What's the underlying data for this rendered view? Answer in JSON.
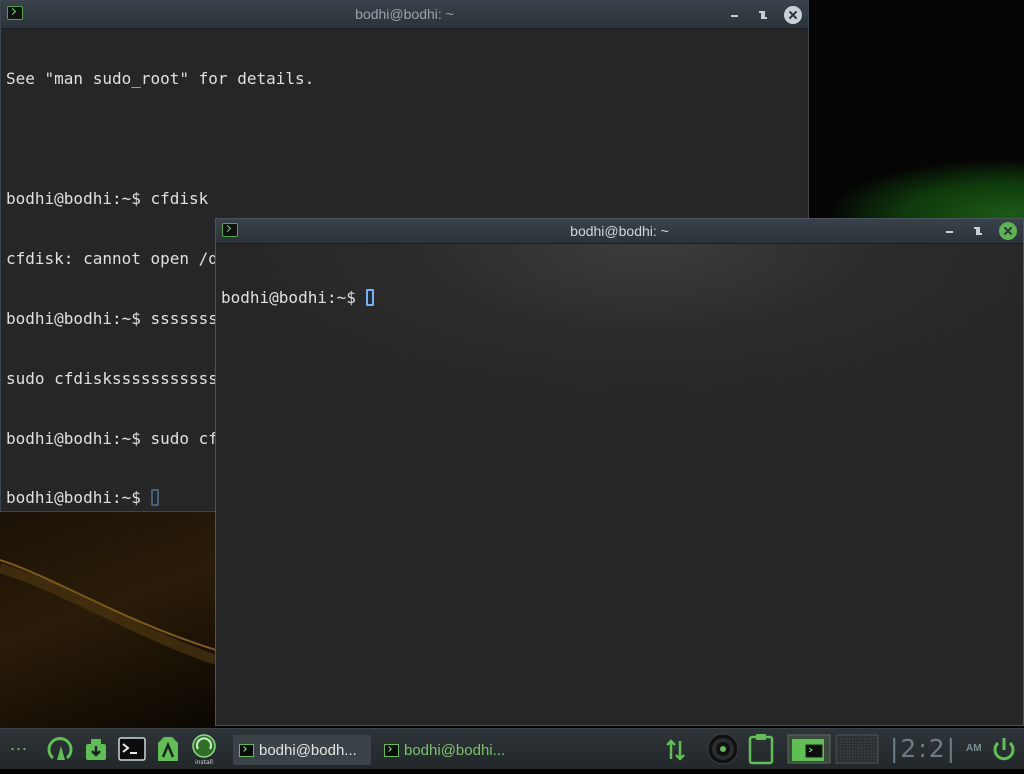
{
  "desktop": {
    "accent_color": "#5fbf52"
  },
  "windows": [
    {
      "id": "terminal-back",
      "title": "bodhi@bodhi: ~",
      "lines": [
        "See \"man sudo_root\" for details.",
        "",
        "bodhi@bodhi:~$ cfdisk",
        "cfdisk: cannot open /dev/sda: Permission denied",
        "bodhi@bodhi:~$ ssssssssssssssssssudo cfdisk",
        "sudo cfdiskssssssssssssssssssudo: command not found",
        "bodhi@bodhi:~$ sudo cfdisk"
      ],
      "bottom_prompt": "bodhi@bodhi:~$ "
    },
    {
      "id": "terminal-front",
      "title": "bodhi@bodhi: ~",
      "prompt": "bodhi@bodhi:~$ "
    }
  ],
  "taskbar": {
    "menu_dots": "⋯",
    "launchers": [
      {
        "icon": "bodhi-menu-icon"
      },
      {
        "icon": "download-icon"
      },
      {
        "icon": "terminal-icon"
      },
      {
        "icon": "app-center-icon"
      },
      {
        "icon": "install-icon",
        "label": "install"
      }
    ],
    "tasks": [
      {
        "label": "bodhi@bodh...",
        "active": true
      },
      {
        "label": "bodhi@bodhi...",
        "active": false
      }
    ],
    "tray": [
      {
        "icon": "network-updown-icon"
      },
      {
        "icon": "disc-icon"
      },
      {
        "icon": "clipboard-icon"
      },
      {
        "icon": "workspace-1-icon"
      },
      {
        "icon": "workspace-2-icon"
      }
    ],
    "clock": "|2:2|",
    "ampm": "AM",
    "power_icon": "power-icon"
  }
}
